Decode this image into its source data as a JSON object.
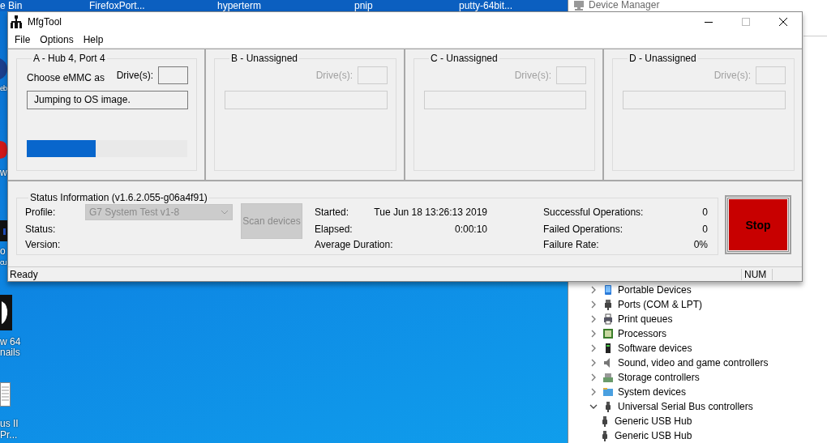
{
  "desktop": {
    "top_icons": [
      {
        "label": "e Bin"
      },
      {
        "label": "FirefoxPort..."
      },
      {
        "label": "hyperterm"
      },
      {
        "label": "pnip"
      },
      {
        "label": "putty-64bit..."
      }
    ],
    "left_icons": [
      {
        "label": "eb"
      },
      {
        "label": "w"
      },
      {
        "label": "o"
      },
      {
        "label": "cu"
      },
      {
        "label": "w 64"
      },
      {
        "label": "nails"
      },
      {
        "label": "us II"
      },
      {
        "label": "Pr..."
      }
    ]
  },
  "device_manager": {
    "title": "Device Manager",
    "tree": [
      {
        "label": "Portable Devices",
        "expanded": false
      },
      {
        "label": "Ports (COM & LPT)",
        "expanded": false
      },
      {
        "label": "Print queues",
        "expanded": false
      },
      {
        "label": "Processors",
        "expanded": false
      },
      {
        "label": "Software devices",
        "expanded": false
      },
      {
        "label": "Sound, video and game controllers",
        "expanded": false
      },
      {
        "label": "Storage controllers",
        "expanded": false
      },
      {
        "label": "System devices",
        "expanded": false
      },
      {
        "label": "Universal Serial Bus controllers",
        "expanded": true,
        "children": [
          {
            "label": "Generic USB Hub"
          },
          {
            "label": "Generic USB Hub"
          }
        ]
      }
    ]
  },
  "mfgtool": {
    "title": "MfgTool",
    "menu": [
      "File",
      "Options",
      "Help"
    ],
    "ports": [
      {
        "title": "A - Hub 4, Port 4",
        "disabled": false,
        "choose_label": "Choose eMMC as",
        "drives_label": "Drive(s):",
        "message": "Jumping to OS image.",
        "level": 0.43
      },
      {
        "title": "B - Unassigned",
        "disabled": true,
        "drives_label": "Drive(s):"
      },
      {
        "title": "C - Unassigned",
        "disabled": true,
        "drives_label": "Drive(s):"
      },
      {
        "title": "D - Unassigned",
        "disabled": true,
        "drives_label": "Drive(s):"
      }
    ],
    "status": {
      "title": "Status Information (v1.6.2.055-g06a4f91)",
      "profile_label": "Profile:",
      "profile": "G7 System Test v1-8",
      "profile_disabled": true,
      "status_label": "Status:",
      "version_label": "Version:",
      "scan_button": {
        "label": "Scan devices",
        "disabled": true
      },
      "timing": [
        {
          "label": "Started:",
          "value": "Tue Jun 18 13:26:13 2019"
        },
        {
          "label": "Elapsed:",
          "value": "0:00:10"
        },
        {
          "label": "Average Duration:"
        }
      ],
      "counts": [
        {
          "label": "Successful Operations:",
          "value": "0"
        },
        {
          "label": "Failed Operations:",
          "value": "0"
        },
        {
          "label": "Failure Rate:",
          "value": "0%"
        }
      ]
    },
    "stop_button": "Stop",
    "status_bar": {
      "message": "Ready",
      "indicator": "NUM"
    }
  }
}
